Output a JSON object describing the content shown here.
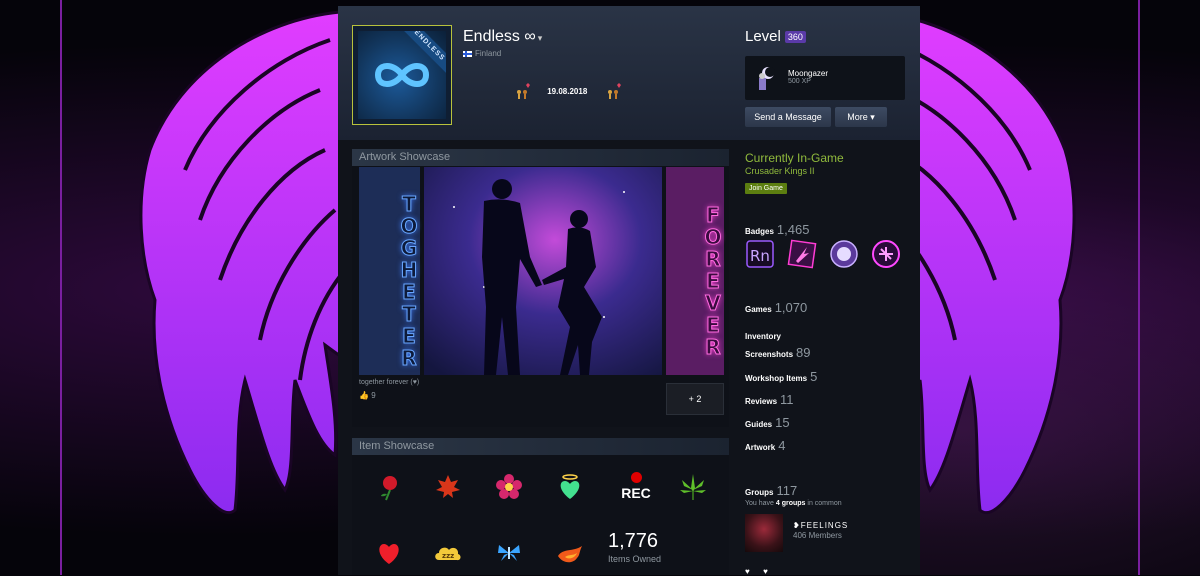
{
  "profile": {
    "persona_name": "Endless ∞",
    "caret": "▾",
    "country": "Finland",
    "avatar_ribbon": "ENDLESS",
    "date": "19.08.2018"
  },
  "level": {
    "label": "Level",
    "value": "360"
  },
  "favorite_badge": {
    "name": "Moongazer",
    "xp": "500 XP"
  },
  "buttons": {
    "send_message": "Send a Message",
    "more": "More ▾"
  },
  "artwork": {
    "title": "Artwork Showcase",
    "left_word": "TOGHETER",
    "right_word": "FOREVER",
    "caption": "together forever (♥)",
    "likes": "9",
    "more": "+ 2"
  },
  "item_showcase": {
    "title": "Item Showcase",
    "rec_label": "REC",
    "count": "1,776",
    "owned_label": "Items Owned",
    "items": [
      "rose",
      "maple-leaf",
      "flower",
      "angel-heart",
      "rec",
      "cannabis-leaf",
      "red-heart",
      "sleepy-cloud",
      "blue-butterfly",
      "flame"
    ]
  },
  "ingame": {
    "heading": "Currently In-Game",
    "game": "Crusader Kings II",
    "join": "Join Game"
  },
  "counts": {
    "badges": {
      "label": "Badges",
      "value": "1,465"
    },
    "games": {
      "label": "Games",
      "value": "1,070"
    },
    "inventory": {
      "label": "Inventory"
    },
    "screenshots": {
      "label": "Screenshots",
      "value": "89"
    },
    "workshop": {
      "label": "Workshop Items",
      "value": "5"
    },
    "reviews": {
      "label": "Reviews",
      "value": "11"
    },
    "guides": {
      "label": "Guides",
      "value": "15"
    },
    "artwork": {
      "label": "Artwork",
      "value": "4"
    }
  },
  "groups": {
    "label": "Groups",
    "value": "117",
    "common_prefix": "You have ",
    "common_count": "4 groups",
    "common_suffix": " in common",
    "group_name": "❥FEELINGS",
    "members": "406 Members"
  },
  "footer_icons": [
    "♥",
    "♥"
  ],
  "colors": {
    "wing": "#d23dff",
    "accent_green": "#90ba3c",
    "level_badge": "#5a3aa8"
  }
}
